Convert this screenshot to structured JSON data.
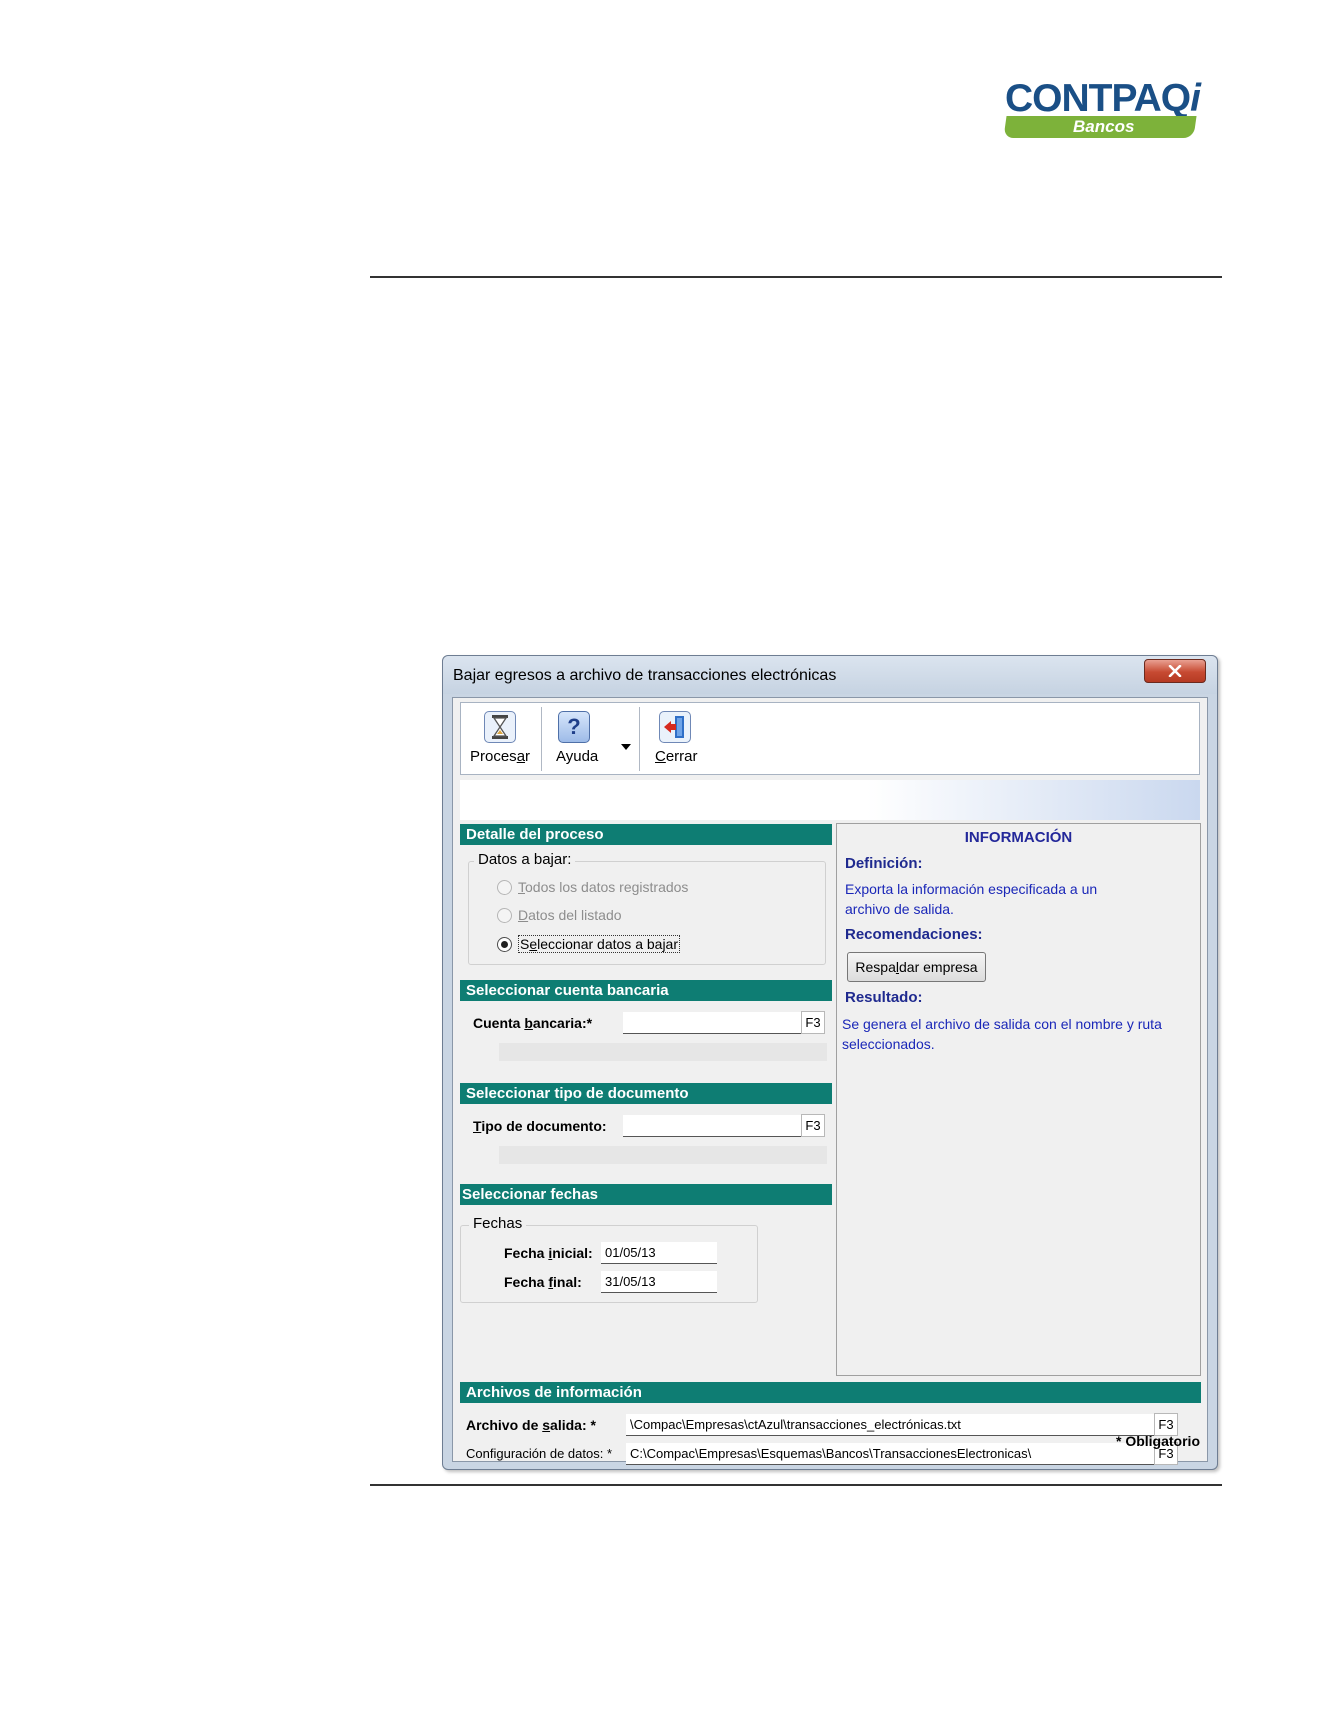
{
  "logo": {
    "brand": "CONTPAQ",
    "brand_i": "i",
    "product": "Bancos"
  },
  "window": {
    "title": "Bajar egresos a archivo de transacciones electrónicas",
    "close_label": "x"
  },
  "toolbar": {
    "procesar_pre": "Proces",
    "procesar_hot": "a",
    "procesar_post": "r",
    "ayuda": "Ayuda",
    "cerrar_hot": "C",
    "cerrar_post": "errar"
  },
  "detalle": {
    "header": "Detalle del proceso",
    "group_title": "Datos a bajar:",
    "options": [
      {
        "hot": "T",
        "rest": "odos los datos registrados",
        "selected": false
      },
      {
        "hot": "D",
        "rest": "atos del listado",
        "selected": false
      },
      {
        "pre": "S",
        "hot": "e",
        "rest": "leccionar datos a bajar",
        "selected": true
      }
    ]
  },
  "cuenta": {
    "header": "Seleccionar cuenta bancaria",
    "label_pre": "Cuenta ",
    "label_hot": "b",
    "label_post": "ancaria:*",
    "value": "",
    "f3": "F3"
  },
  "tipo": {
    "header": "Seleccionar tipo de documento",
    "label_hot": "T",
    "label_post": "ipo de documento:",
    "value": "",
    "f3": "F3"
  },
  "fechas": {
    "header": "Seleccionar fechas",
    "group_title": "Fechas",
    "inicial_pre": "Fecha ",
    "inicial_hot": "i",
    "inicial_post": "nicial:",
    "inicial_value": "01/05/13",
    "final_pre": "Fecha ",
    "final_hot": "f",
    "final_post": "inal:",
    "final_value": "31/05/13"
  },
  "info": {
    "title": "INFORMACIÓN",
    "definicion_h": "Definición:",
    "definicion_p": "Exporta la información especificada a un archivo de salida.",
    "recomendaciones_h": "Recomendaciones:",
    "respaldar_pre": "Respa",
    "respaldar_hot": "l",
    "respaldar_post": "dar empresa",
    "resultado_h": "Resultado:",
    "resultado_p": "Se genera el archivo de salida con el nombre y ruta seleccionados."
  },
  "archivos": {
    "header": "Archivos de información",
    "salida_pre": "Archivo de ",
    "salida_hot": "s",
    "salida_post": "alida: *",
    "salida_value": "\\Compac\\Empresas\\ctAzul\\transacciones_electrónicas.txt",
    "config_pre": "Confi",
    "config_hot": "g",
    "config_post": "uración de datos: *",
    "config_value": "C:\\Compac\\Empresas\\Esquemas\\Bancos\\TransaccionesElectronicas\\",
    "f3": "F3"
  },
  "required_note": "* Obligatorio"
}
